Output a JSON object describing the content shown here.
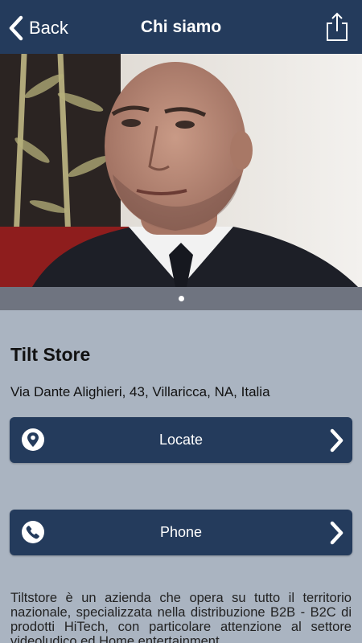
{
  "navbar": {
    "back_label": "Back",
    "title": "Chi siamo",
    "share_icon": "share-icon"
  },
  "hero": {
    "image": "profile-photo",
    "carousel_dots": 1,
    "active_dot": 0
  },
  "store": {
    "name": "Tilt Store",
    "address": "Via Dante Alighieri, 43, Villaricca, NA, Italia"
  },
  "actions": {
    "locate_label": "Locate",
    "locate_icon": "map-pin-icon",
    "phone_label": "Phone",
    "phone_icon": "phone-icon"
  },
  "description": "Tiltstore è un azienda che opera su tutto il territorio nazionale, specializzata nella distribuzione B2B - B2C di prodotti HiTech, con particolare attenzione al settore videoludico ed Home entertainment.",
  "colors": {
    "navbar": "#243b5c",
    "background": "#aab4c1",
    "button": "#243b5c"
  }
}
